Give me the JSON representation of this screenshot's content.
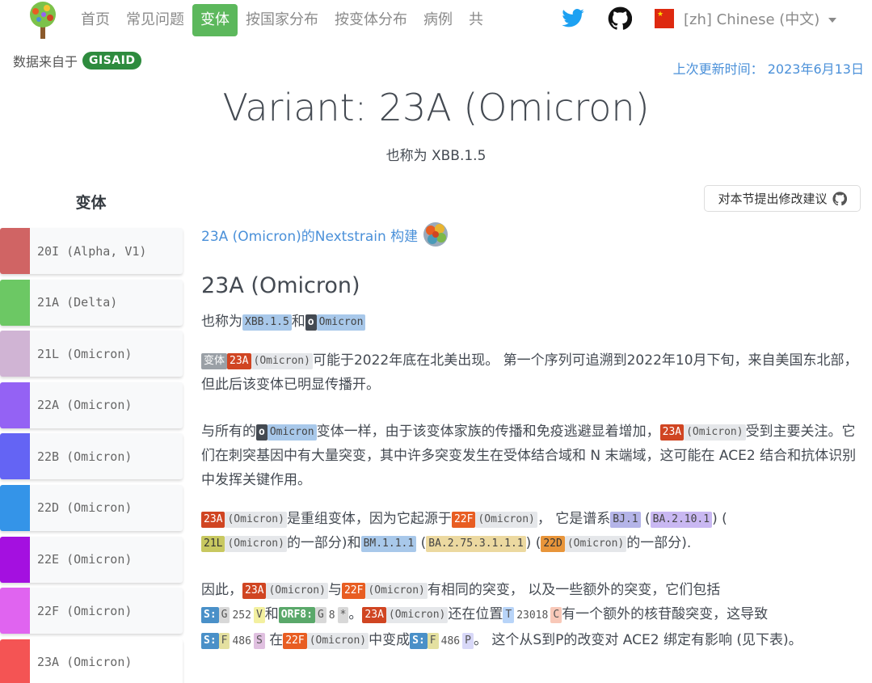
{
  "nav": {
    "links": [
      "首页",
      "常见问题",
      "变体",
      "按国家分布",
      "按变体分布",
      "病例",
      "共"
    ],
    "active_index": 2,
    "lang_code": "[zh]",
    "lang_name": "Chinese (中文)"
  },
  "data_from": {
    "label": "数据来自于",
    "badge": "GISAID"
  },
  "updated": "上次更新时间： 2023年6月13日",
  "page": {
    "title": "Variant: 23A (Omicron)",
    "subtitle": "也称为 XBB.1.5"
  },
  "sidebar": {
    "heading": "变体",
    "items": [
      {
        "label": "20I (Alpha, V1)",
        "color": "#d06464"
      },
      {
        "label": "21A (Delta)",
        "color": "#6cc864"
      },
      {
        "label": "21L (Omicron)",
        "color": "#d0b4d4"
      },
      {
        "label": "22A (Omicron)",
        "color": "#9462f4"
      },
      {
        "label": "22B (Omicron)",
        "color": "#6464f4"
      },
      {
        "label": "22D (Omicron)",
        "color": "#3494e8"
      },
      {
        "label": "22E (Omicron)",
        "color": "#a410e0"
      },
      {
        "label": "22F (Omicron)",
        "color": "#e064f0"
      },
      {
        "label": "23A (Omicron)",
        "color": "#f45454"
      }
    ]
  },
  "main": {
    "suggest_button": "对本节提出修改建议",
    "nextstrain_link": "23A (Omicron)的Nextstrain 构建",
    "heading": "23A (Omicron)",
    "aka": {
      "prefix": "也称为",
      "tag1": "XBB.1.5",
      "and": "和",
      "o": "o",
      "tag2": "Omicron"
    },
    "p1": {
      "tag_variant": "变体",
      "tag_code": "23A",
      "tag_name": "(Omicron)",
      "text": "可能于2022年底在北美出现。 第一个序列可追溯到2022年10月下旬，来自美国东北部，但此后该变体已明显传播开。"
    },
    "p2": {
      "pre": "与所有的",
      "o": "o",
      "omicron": "Omicron",
      "mid": "变体一样，由于该变体家族的传播和免疫逃避显着增加，",
      "code": "23A",
      "name": "(Omicron)",
      "post": "受到主要关注。它们在刺突基因中有大量突变，其中许多突变发生在受体结合域和 N 末端域，这可能在 ACE2 结合和抗体识别中发挥关键作用。"
    },
    "p3": {
      "code1": "23A",
      "name1": "(Omicron)",
      "t1": "是重组变体，因为它起源于",
      "code2": "22F",
      "name2": "(Omicron)",
      "t2": "， 它是谱系",
      "bj": "BJ.1",
      "paren1": "(",
      "ba2101": "BA.2.10.1",
      "paren2": ") (",
      "code3": "21L",
      "name3": "(Omicron)",
      "t3": "的一部分)和",
      "bm": "BM.1.1.1",
      "paren3": "(",
      "ba275": "BA.2.75.3.1.1.1",
      "paren4": ") (",
      "code4": "22D",
      "name4": "(Omicron)",
      "t4": "的一部分)."
    },
    "p4": {
      "pre": "因此，",
      "code1": "23A",
      "name1": "(Omicron)",
      "with": "与",
      "code2": "22F",
      "name2": "(Omicron)",
      "t1": "有相同的突变， 以及一些额外的突变，它们包括",
      "s1": "S:",
      "s1a": "G",
      "s1n": "252",
      "s1b": "V",
      "and": "和",
      "orf": "ORF8:",
      "orfa": "G",
      "orfn": "8",
      "orfb": "*",
      "dot": "。",
      "code3": "23A",
      "name3": "(Omicron)",
      "t2": "还在位置",
      "pa": "T",
      "pn": "23018",
      "pb": "C",
      "t3": "有一个额外的核苷酸突变，这导致",
      "s2": "S:",
      "s2a": "F",
      "s2n": "486",
      "s2b": "S",
      "in": "在",
      "code4": "22F",
      "name4": "(Omicron)",
      "t4": "中变成",
      "s3": "S:",
      "s3a": "F",
      "s3n": "486",
      "s3b": "P",
      "t5": "。 这个从S到P的改变对 ACE2 绑定有影响 (见下表)。"
    }
  },
  "colors": {
    "accent": "#5cb85c",
    "link": "#4a90d9",
    "twitter": "#1da1f2"
  }
}
